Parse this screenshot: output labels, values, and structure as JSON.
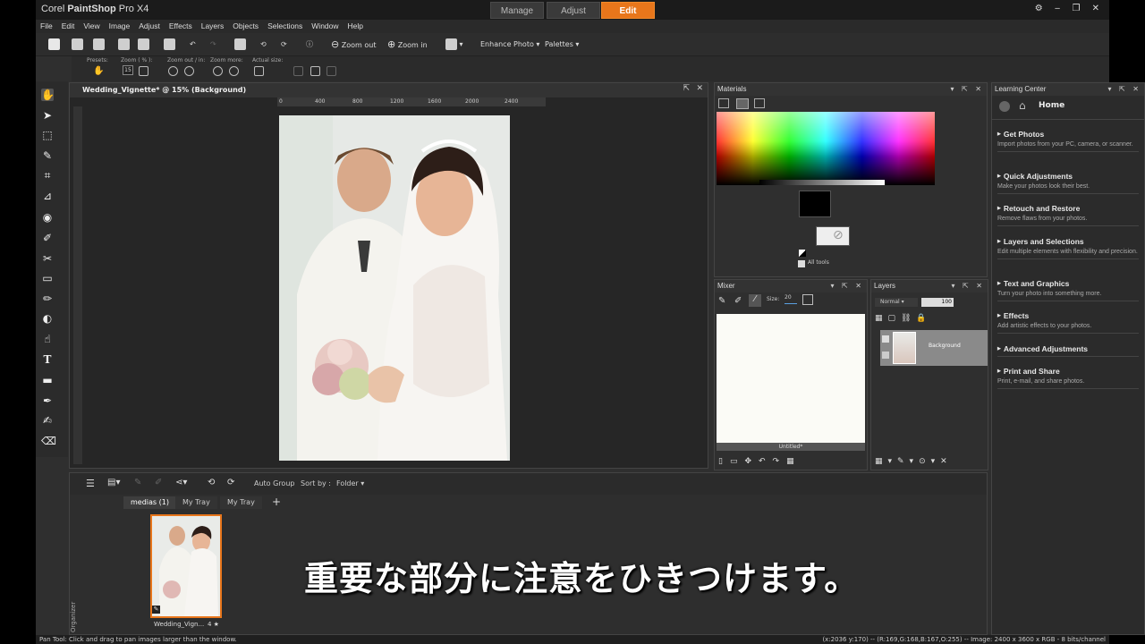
{
  "app": {
    "brand_prefix": "Corel ",
    "brand_main": "PaintShop",
    "brand_suffix": " Pro X4"
  },
  "workspace_tabs": [
    "Manage",
    "Adjust",
    "Edit"
  ],
  "active_tab": "Edit",
  "window_controls": "⚙ ‒ ❐ ✕",
  "menu": [
    "File",
    "Edit",
    "View",
    "Image",
    "Adjust",
    "Effects",
    "Layers",
    "Objects",
    "Selections",
    "Window",
    "Help"
  ],
  "toolbar": {
    "zoom_out": "Zoom out",
    "zoom_in": "Zoom in",
    "enhance_photo": "Enhance Photo",
    "palettes": "Palettes"
  },
  "tool_options": {
    "presets": "Presets:",
    "zoom_pct_label": "Zoom ( % ):",
    "zoom_value": "15",
    "zoom_out_in": "Zoom out / in:",
    "zoom_more": "Zoom more:",
    "actual_size": "Actual size:"
  },
  "document": {
    "title": "Wedding_Vignette* @ 15% (Background)",
    "ruler_ticks": [
      "0",
      "400",
      "800",
      "1200",
      "1600",
      "2000",
      "2400"
    ]
  },
  "materials": {
    "title": "Materials",
    "all_tools": "All tools"
  },
  "mixer": {
    "title": "Mixer",
    "size_label": "Size:",
    "size_value": "20",
    "canvas_name": "Untitled*"
  },
  "layers": {
    "title": "Layers",
    "blend_mode": "Normal",
    "opacity": "100",
    "layer_name": "Background"
  },
  "learning_center": {
    "title": "Learning Center",
    "home": "Home",
    "sections": [
      {
        "heading": "Get Photos",
        "desc": "Import photos from your PC, camera, or scanner."
      },
      {
        "heading": "Quick Adjustments",
        "desc": "Make your photos look their best."
      },
      {
        "heading": "Retouch and Restore",
        "desc": "Remove flaws from your photos."
      },
      {
        "heading": "Layers and Selections",
        "desc": "Edit multiple elements with flexibility and precision."
      },
      {
        "heading": "Text and Graphics",
        "desc": "Turn your photo into something more."
      },
      {
        "heading": "Effects",
        "desc": "Add artistic effects to your photos."
      },
      {
        "heading": "Advanced Adjustments",
        "desc": ""
      },
      {
        "heading": "Print and Share",
        "desc": "Print, e-mail, and share photos."
      }
    ]
  },
  "organizer": {
    "auto_group": "Auto Group",
    "sort_by": "Sort by :",
    "sort_value": "Folder",
    "tabs": [
      "medias (1)",
      "My Tray",
      "My Tray"
    ],
    "add_tab": "+",
    "side_label": "Organizer",
    "thumb_name": "Wedding_Vign...",
    "thumb_rating": "4 ★"
  },
  "subtitle": "重要な部分に注意をひきつけます。",
  "status": {
    "left": "Pan Tool: Click and drag to pan images larger than the window.",
    "right": "(x:2036 y:170) -- (R:169,G:168,B:167,O:255) -- Image: 2400 x 3600 x RGB - 8 bits/channel"
  }
}
